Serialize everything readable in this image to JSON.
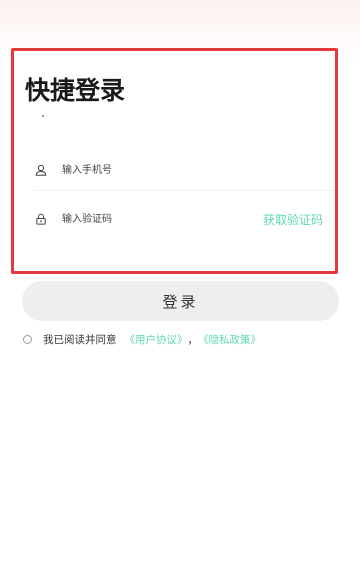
{
  "login": {
    "title": "快捷登录",
    "phone": {
      "placeholder": "输入手机号",
      "value": "",
      "icon": "user-icon"
    },
    "code": {
      "placeholder": "输入验证码",
      "value": "",
      "icon": "lock-icon"
    },
    "get_code_label": "获取验证码",
    "submit_label": "登录"
  },
  "agreement": {
    "text": "我已阅读并同意",
    "user_agreement": "《用户协议》",
    "separator": "，",
    "privacy_policy": "《隐私政策》",
    "checked": false
  },
  "colors": {
    "accent": "#5ed8b2",
    "highlight_border": "#e3393c",
    "button_bg": "#eeeeee"
  }
}
